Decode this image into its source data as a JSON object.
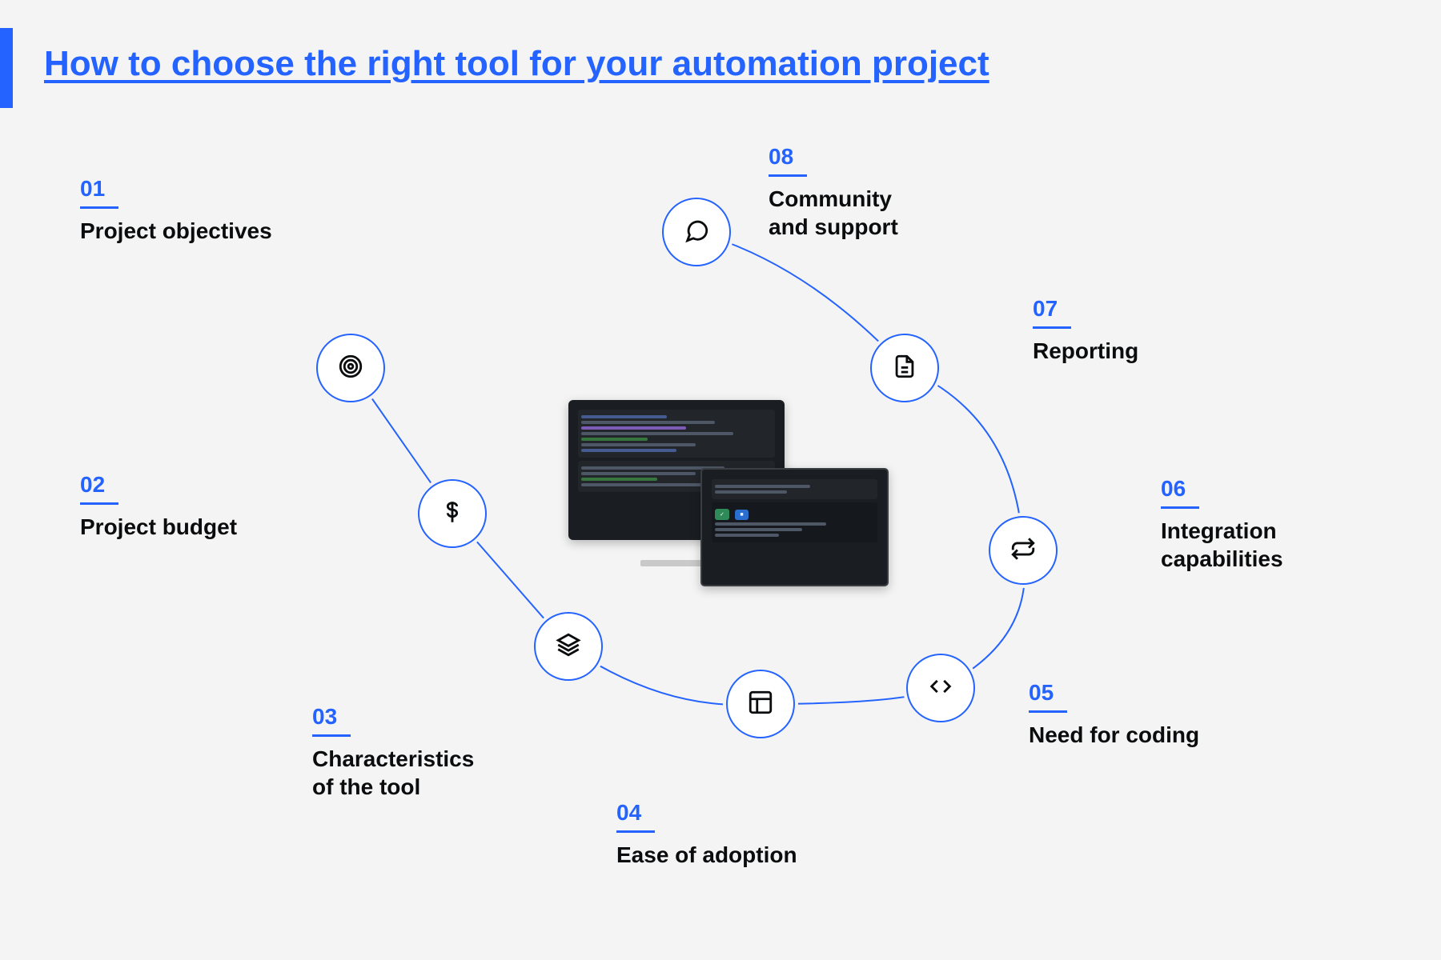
{
  "title": "How to choose the right tool for your automation project",
  "colors": {
    "accent": "#2463ff"
  },
  "items": [
    {
      "num": "01",
      "label": "Project objectives",
      "icon": "target"
    },
    {
      "num": "02",
      "label": "Project budget",
      "icon": "dollar"
    },
    {
      "num": "03",
      "label": "Characteristics\nof the tool",
      "icon": "layers"
    },
    {
      "num": "04",
      "label": "Ease of adoption",
      "icon": "layout"
    },
    {
      "num": "05",
      "label": "Need for coding",
      "icon": "code"
    },
    {
      "num": "06",
      "label": "Integration\ncapabilities",
      "icon": "repeat"
    },
    {
      "num": "07",
      "label": "Reporting",
      "icon": "file"
    },
    {
      "num": "08",
      "label": "Community\nand support",
      "icon": "chat"
    }
  ]
}
